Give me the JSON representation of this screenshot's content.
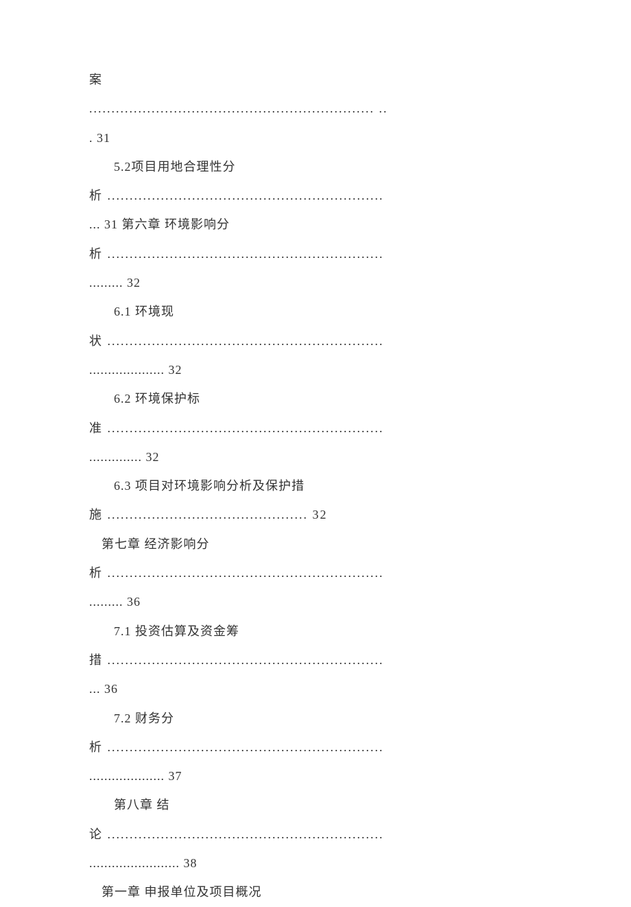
{
  "toc": {
    "line0": "案",
    "item1": {
      "dots": " ................................................................ ..",
      "continuation": ". 31"
    },
    "item2": {
      "label": "5.2项目用地合理性分",
      "continuation1": "析 ..............................................................",
      "continuation2": "... 31 第六章 环境影响分"
    },
    "item3": {
      "continuation1": "析 ..............................................................",
      "continuation2": "......... 32"
    },
    "item4": {
      "label": "6.1 环境现",
      "continuation1": "状 ..............................................................",
      "continuation2": " .................... 32"
    },
    "item5": {
      "label": "6.2 环境保护标",
      "continuation1": "准 ..............................................................",
      "continuation2": " .............. 32"
    },
    "item6": {
      "label": "6.3 项目对环境影响分析及保护措",
      "continuation1": "施 ............................................. 32"
    },
    "item7": {
      "label": "第七章 经济影响分",
      "continuation1": "析 ..............................................................",
      "continuation2": "......... 36"
    },
    "item8": {
      "label": "7.1 投资估算及资金筹",
      "continuation1": "措 ..............................................................",
      "continuation2": "... 36"
    },
    "item9": {
      "label": "7.2 财务分",
      "continuation1": "析 ..............................................................",
      "continuation2": " .................... 37"
    },
    "item10": {
      "label": "第八章 结",
      "continuation1": "论 ..............................................................",
      "continuation2": "........................ 38"
    },
    "chapter_heading": "第一章 申报单位及项目概况"
  }
}
